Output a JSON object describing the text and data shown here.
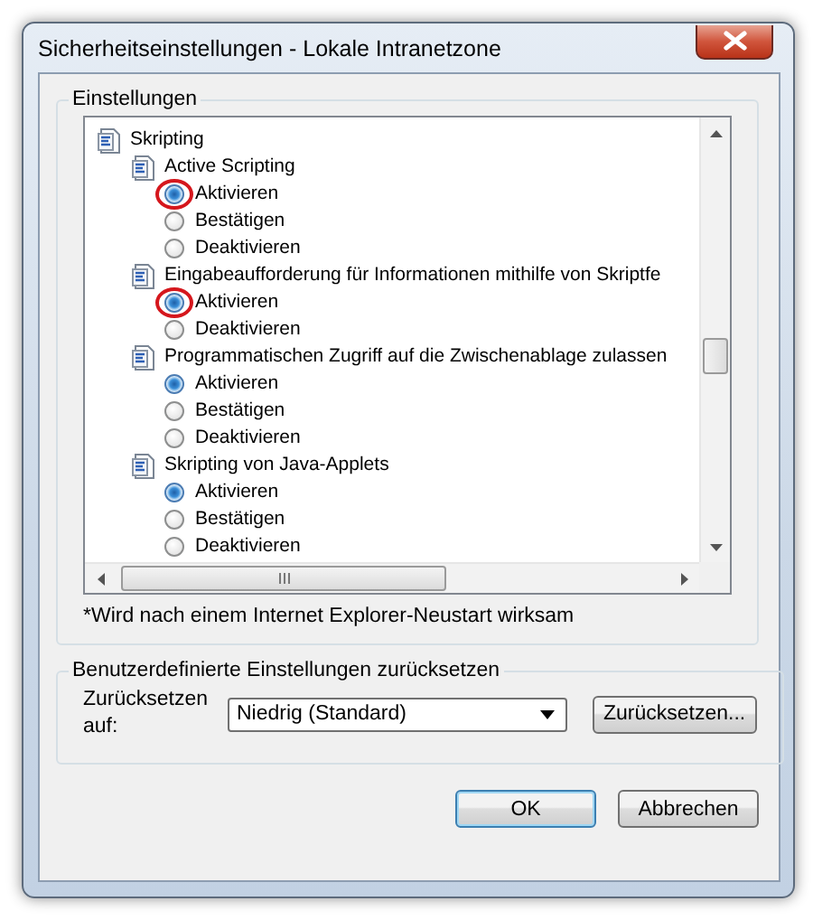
{
  "window": {
    "title": "Sicherheitseinstellungen - Lokale Intranetzone"
  },
  "settings_group": {
    "legend": "Einstellungen",
    "tree": [
      {
        "kind": "category",
        "label": "Skripting",
        "children": [
          {
            "kind": "setting",
            "label": "Active Scripting",
            "children": [
              {
                "kind": "option",
                "label": "Aktivieren",
                "selected": true,
                "highlighted": true
              },
              {
                "kind": "option",
                "label": "Bestätigen",
                "selected": false,
                "highlighted": false
              },
              {
                "kind": "option",
                "label": "Deaktivieren",
                "selected": false,
                "highlighted": false
              }
            ]
          },
          {
            "kind": "setting",
            "label": "Eingabeaufforderung für Informationen mithilfe von Skriptfe",
            "children": [
              {
                "kind": "option",
                "label": "Aktivieren",
                "selected": true,
                "highlighted": true
              },
              {
                "kind": "option",
                "label": "Deaktivieren",
                "selected": false,
                "highlighted": false
              }
            ]
          },
          {
            "kind": "setting",
            "label": "Programmatischen Zugriff auf die Zwischenablage zulassen",
            "children": [
              {
                "kind": "option",
                "label": "Aktivieren",
                "selected": true,
                "highlighted": false
              },
              {
                "kind": "option",
                "label": "Bestätigen",
                "selected": false,
                "highlighted": false
              },
              {
                "kind": "option",
                "label": "Deaktivieren",
                "selected": false,
                "highlighted": false
              }
            ]
          },
          {
            "kind": "setting",
            "label": "Skripting von Java-Applets",
            "children": [
              {
                "kind": "option",
                "label": "Aktivieren",
                "selected": true,
                "highlighted": false
              },
              {
                "kind": "option",
                "label": "Bestätigen",
                "selected": false,
                "highlighted": false
              },
              {
                "kind": "option",
                "label": "Deaktivieren",
                "selected": false,
                "highlighted": false
              }
            ]
          }
        ]
      }
    ],
    "footnote": "*Wird nach einem Internet Explorer-Neustart wirksam"
  },
  "reset_group": {
    "legend": "Benutzerdefinierte Einstellungen zurücksetzen",
    "label": "Zurücksetzen auf:",
    "value": "Niedrig (Standard)",
    "button": "Zurücksetzen..."
  },
  "buttons": [
    "OK",
    "Abbrechen"
  ]
}
